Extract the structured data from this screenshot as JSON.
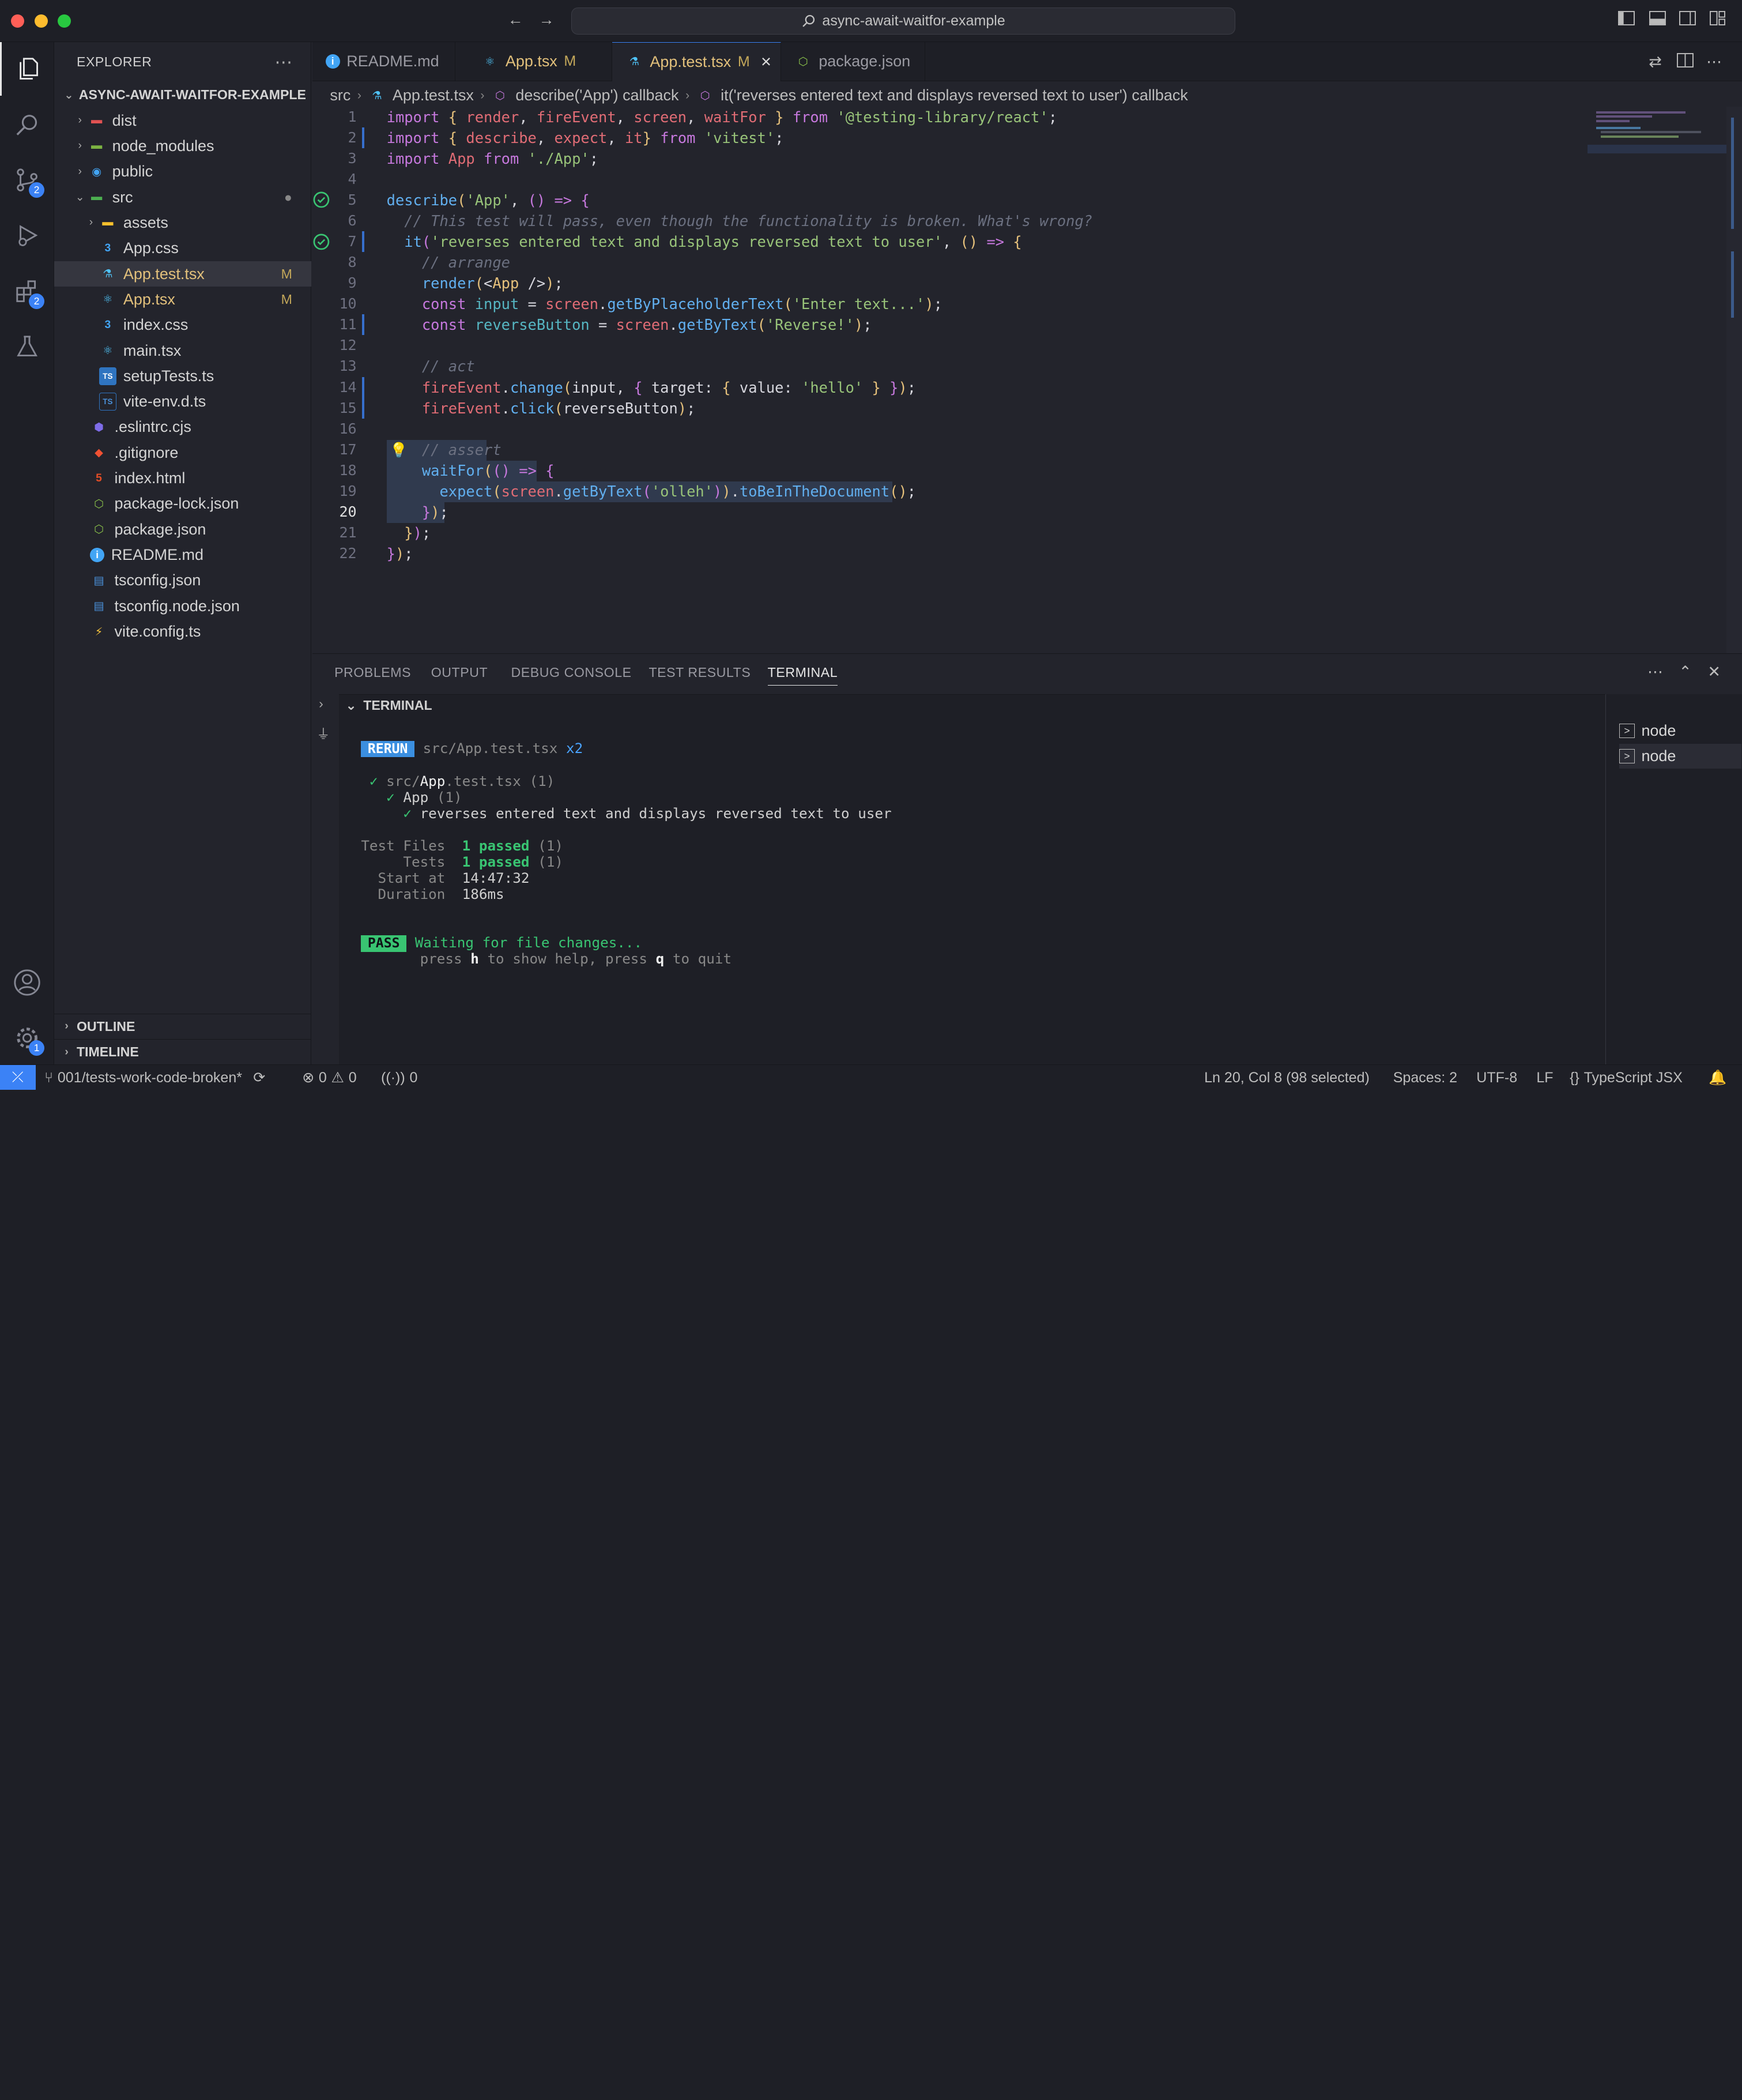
{
  "window": {
    "title": "async-await-waitfor-example"
  },
  "activity_badges": {
    "scm": "2",
    "extensions": "2",
    "settings": "1"
  },
  "sidebar": {
    "header": "EXPLORER",
    "project": "ASYNC-AWAIT-WAITFOR-EXAMPLE",
    "items": [
      {
        "label": "dist",
        "status": ""
      },
      {
        "label": "node_modules",
        "status": ""
      },
      {
        "label": "public",
        "status": ""
      },
      {
        "label": "src",
        "status": ""
      },
      {
        "label": "assets",
        "status": ""
      },
      {
        "label": "App.css",
        "status": ""
      },
      {
        "label": "App.test.tsx",
        "status": "M"
      },
      {
        "label": "App.tsx",
        "status": "M"
      },
      {
        "label": "index.css",
        "status": ""
      },
      {
        "label": "main.tsx",
        "status": ""
      },
      {
        "label": "setupTests.ts",
        "status": ""
      },
      {
        "label": "vite-env.d.ts",
        "status": ""
      },
      {
        "label": ".eslintrc.cjs",
        "status": ""
      },
      {
        "label": ".gitignore",
        "status": ""
      },
      {
        "label": "index.html",
        "status": ""
      },
      {
        "label": "package-lock.json",
        "status": ""
      },
      {
        "label": "package.json",
        "status": ""
      },
      {
        "label": "README.md",
        "status": ""
      },
      {
        "label": "tsconfig.json",
        "status": ""
      },
      {
        "label": "tsconfig.node.json",
        "status": ""
      },
      {
        "label": "vite.config.ts",
        "status": ""
      }
    ],
    "outline": "OUTLINE",
    "timeline": "TIMELINE"
  },
  "tabs": [
    {
      "label": "README.md",
      "status": ""
    },
    {
      "label": "App.tsx",
      "status": "M"
    },
    {
      "label": "App.test.tsx",
      "status": "M"
    },
    {
      "label": "package.json",
      "status": ""
    }
  ],
  "breadcrumb": [
    "src",
    "App.test.tsx",
    "describe('App') callback",
    "it('reverses entered text and displays reversed text to user') callback"
  ],
  "editor": {
    "line_numbers": [
      "1",
      "2",
      "3",
      "4",
      "5",
      "6",
      "7",
      "8",
      "9",
      "10",
      "11",
      "12",
      "13",
      "14",
      "15",
      "16",
      "17",
      "18",
      "19",
      "20",
      "21",
      "22"
    ],
    "lines": [
      [
        [
          "k",
          "import"
        ],
        [
          "o",
          " "
        ],
        [
          "p",
          "{"
        ],
        [
          "o",
          " "
        ],
        [
          "v",
          "render"
        ],
        [
          "o",
          ", "
        ],
        [
          "v",
          "fireEvent"
        ],
        [
          "o",
          ", "
        ],
        [
          "v",
          "screen"
        ],
        [
          "o",
          ", "
        ],
        [
          "v",
          "waitFor"
        ],
        [
          "o",
          " "
        ],
        [
          "p",
          "}"
        ],
        [
          "o",
          " "
        ],
        [
          "k",
          "from"
        ],
        [
          "o",
          " "
        ],
        [
          "s",
          "'@testing-library/react'"
        ],
        [
          "o",
          ";"
        ]
      ],
      [
        [
          "k",
          "import"
        ],
        [
          "o",
          " "
        ],
        [
          "p",
          "{"
        ],
        [
          "o",
          " "
        ],
        [
          "v",
          "describe"
        ],
        [
          "o",
          ", "
        ],
        [
          "v",
          "expect"
        ],
        [
          "o",
          ", "
        ],
        [
          "v",
          "it"
        ],
        [
          "p",
          "}"
        ],
        [
          "o",
          " "
        ],
        [
          "k",
          "from"
        ],
        [
          "o",
          " "
        ],
        [
          "s",
          "'vitest'"
        ],
        [
          "o",
          ";"
        ]
      ],
      [
        [
          "k",
          "import"
        ],
        [
          "o",
          " "
        ],
        [
          "v",
          "App"
        ],
        [
          "o",
          " "
        ],
        [
          "k",
          "from"
        ],
        [
          "o",
          " "
        ],
        [
          "s",
          "'./App'"
        ],
        [
          "o",
          ";"
        ]
      ],
      [],
      [
        [
          "f",
          "describe"
        ],
        [
          "p",
          "("
        ],
        [
          "s",
          "'App'"
        ],
        [
          "o",
          ", "
        ],
        [
          "k",
          "()"
        ],
        [
          "o",
          " "
        ],
        [
          "k",
          "=>"
        ],
        [
          "o",
          " "
        ],
        [
          "k",
          "{"
        ]
      ],
      [
        [
          "o",
          "  "
        ],
        [
          "c",
          "// This test will pass, even though the functionality is broken. What's wrong?"
        ]
      ],
      [
        [
          "o",
          "  "
        ],
        [
          "f",
          "it"
        ],
        [
          "k",
          "("
        ],
        [
          "s",
          "'reverses entered text and displays reversed text to user'"
        ],
        [
          "o",
          ", "
        ],
        [
          "p",
          "()"
        ],
        [
          "o",
          " "
        ],
        [
          "k",
          "=>"
        ],
        [
          "o",
          " "
        ],
        [
          "p",
          "{"
        ]
      ],
      [
        [
          "o",
          "    "
        ],
        [
          "c",
          "// arrange"
        ]
      ],
      [
        [
          "o",
          "    "
        ],
        [
          "f",
          "render"
        ],
        [
          "p",
          "("
        ],
        [
          "o",
          "<"
        ],
        [
          "p",
          "App"
        ],
        [
          "o",
          " />"
        ],
        [
          "p",
          ")"
        ],
        [
          "o",
          ";"
        ]
      ],
      [
        [
          "o",
          "    "
        ],
        [
          "k",
          "const"
        ],
        [
          "o",
          " "
        ],
        [
          "t",
          "input"
        ],
        [
          "o",
          " = "
        ],
        [
          "v",
          "screen"
        ],
        [
          "o",
          "."
        ],
        [
          "f",
          "getByPlaceholderText"
        ],
        [
          "p",
          "("
        ],
        [
          "s",
          "'Enter text...'"
        ],
        [
          "p",
          ")"
        ],
        [
          "o",
          ";"
        ]
      ],
      [
        [
          "o",
          "    "
        ],
        [
          "k",
          "const"
        ],
        [
          "o",
          " "
        ],
        [
          "t",
          "reverseButton"
        ],
        [
          "o",
          " = "
        ],
        [
          "v",
          "screen"
        ],
        [
          "o",
          "."
        ],
        [
          "f",
          "getByText"
        ],
        [
          "p",
          "("
        ],
        [
          "s",
          "'Reverse!'"
        ],
        [
          "p",
          ")"
        ],
        [
          "o",
          ";"
        ]
      ],
      [],
      [
        [
          "o",
          "    "
        ],
        [
          "c",
          "// act"
        ]
      ],
      [
        [
          "o",
          "    "
        ],
        [
          "v",
          "fireEvent"
        ],
        [
          "o",
          "."
        ],
        [
          "f",
          "change"
        ],
        [
          "p",
          "("
        ],
        [
          "o",
          "input, "
        ],
        [
          "k",
          "{"
        ],
        [
          "o",
          " target: "
        ],
        [
          "p",
          "{"
        ],
        [
          "o",
          " value: "
        ],
        [
          "s",
          "'hello'"
        ],
        [
          "o",
          " "
        ],
        [
          "p",
          "}"
        ],
        [
          "o",
          " "
        ],
        [
          "k",
          "}"
        ],
        [
          "p",
          ")"
        ],
        [
          "o",
          ";"
        ]
      ],
      [
        [
          "o",
          "    "
        ],
        [
          "v",
          "fireEvent"
        ],
        [
          "o",
          "."
        ],
        [
          "f",
          "click"
        ],
        [
          "p",
          "("
        ],
        [
          "o",
          "reverseButton"
        ],
        [
          "p",
          ")"
        ],
        [
          "o",
          ";"
        ]
      ],
      [],
      [
        [
          "o",
          "    "
        ],
        [
          "c",
          "// assert"
        ]
      ],
      [
        [
          "o",
          "    "
        ],
        [
          "f",
          "waitFor"
        ],
        [
          "p",
          "("
        ],
        [
          "k",
          "()"
        ],
        [
          "o",
          " "
        ],
        [
          "k",
          "=>"
        ],
        [
          "o",
          " "
        ],
        [
          "k",
          "{"
        ]
      ],
      [
        [
          "o",
          "      "
        ],
        [
          "f",
          "expect"
        ],
        [
          "p",
          "("
        ],
        [
          "v",
          "screen"
        ],
        [
          "o",
          "."
        ],
        [
          "f",
          "getByText"
        ],
        [
          "k",
          "("
        ],
        [
          "s",
          "'olleh'"
        ],
        [
          "k",
          ")"
        ],
        [
          "p",
          ")"
        ],
        [
          "o",
          "."
        ],
        [
          "f",
          "toBeInTheDocument"
        ],
        [
          "p",
          "()"
        ],
        [
          "o",
          ";"
        ]
      ],
      [
        [
          "o",
          "    "
        ],
        [
          "k",
          "}"
        ],
        [
          "p",
          ")"
        ],
        [
          "o",
          ";"
        ]
      ],
      [
        [
          "o",
          "  "
        ],
        [
          "p",
          "}"
        ],
        [
          "k",
          ")"
        ],
        [
          "o",
          ";"
        ]
      ],
      [
        [
          "k",
          "}"
        ],
        [
          "p",
          ")"
        ],
        [
          "o",
          ";"
        ]
      ]
    ]
  },
  "panel": {
    "tabs": [
      "PROBLEMS",
      "OUTPUT",
      "DEBUG CONSOLE",
      "TEST RESULTS",
      "TERMINAL"
    ],
    "section_title": "TERMINAL",
    "terminal": {
      "rerun_label": "RERUN",
      "rerun_file": "src/App.test.tsx",
      "rerun_count": "x2",
      "suite_check": "✓",
      "suite_dir": "src/",
      "suite_file": "App",
      "suite_ext": ".test.tsx",
      "suite_count": "(1)",
      "describe_name": "App",
      "describe_count": "(1)",
      "test_name": "reverses entered text and displays reversed text to user",
      "test_files_label": "Test Files",
      "test_files_value": "1 passed",
      "test_files_count": "(1)",
      "tests_label": "Tests",
      "tests_value": "1 passed",
      "tests_count": "(1)",
      "start_label": "Start at",
      "start_value": "14:47:32",
      "duration_label": "Duration",
      "duration_value": "186ms",
      "pass_label": "PASS",
      "waiting": "Waiting for file changes...",
      "help_press": "press",
      "help_h": "h",
      "help_mid": "to show help, press",
      "help_q": "q",
      "help_end": "to quit"
    },
    "terminals": [
      "node",
      "node"
    ]
  },
  "statusbar": {
    "branch": "001/tests-work-code-broken*",
    "errors": "0",
    "warnings": "0",
    "ports": "0",
    "position": "Ln 20, Col 8 (98 selected)",
    "spaces": "Spaces: 2",
    "encoding": "UTF-8",
    "eol": "LF",
    "language": "TypeScript JSX"
  },
  "colors": {
    "accent": "#3b82f6",
    "modified": "#e2c07b",
    "pass": "#39c472",
    "rerun": "#3b8fe0"
  }
}
